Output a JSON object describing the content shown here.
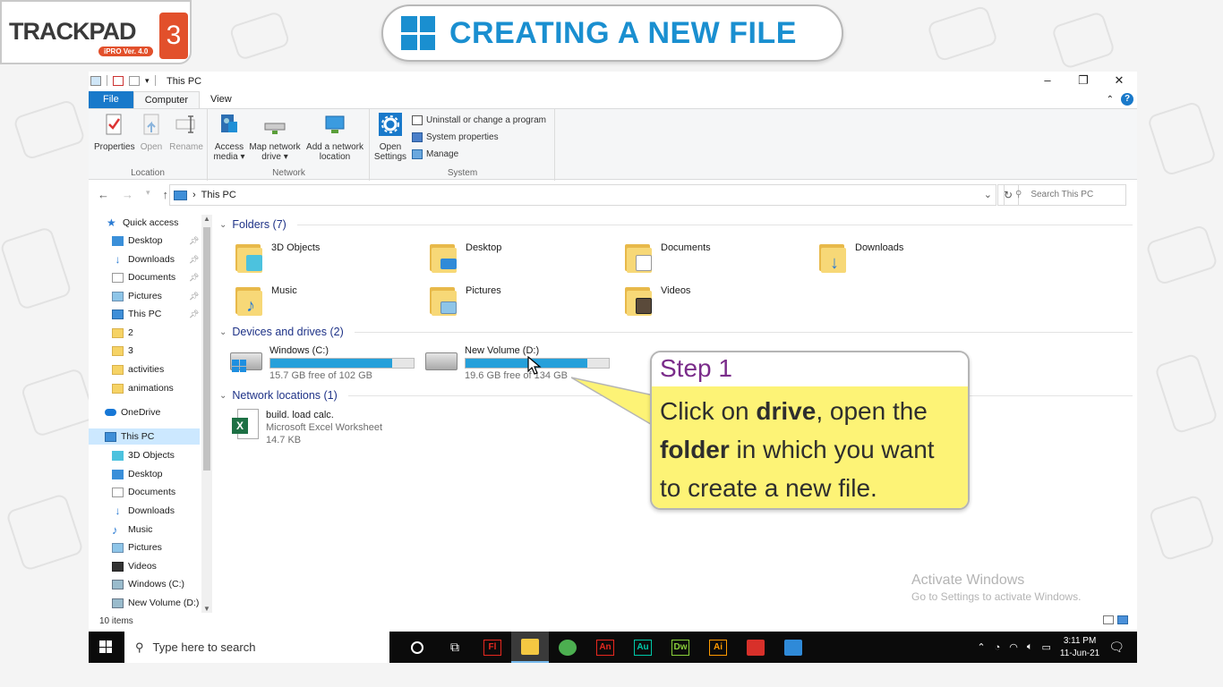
{
  "logo": {
    "word": "TRACKPAD",
    "sub": "iPRO Ver. 4.0",
    "num": "3"
  },
  "banner": {
    "title": "CREATING A NEW FILE"
  },
  "window": {
    "title": "This PC",
    "tabs": [
      "File",
      "Computer",
      "View"
    ],
    "ribbon": {
      "location": {
        "name": "Location",
        "buttons": [
          "Properties",
          "Open",
          "Rename"
        ]
      },
      "network": {
        "name": "Network",
        "access_media": "Access media ▾",
        "map_drive": "Map network drive ▾",
        "add_location": "Add a network location"
      },
      "system": {
        "name": "System",
        "open_settings": "Open Settings",
        "uninstall": "Uninstall or change a program",
        "sys_props": "System properties",
        "manage": "Manage"
      }
    },
    "address": {
      "path": "This PC",
      "search_placeholder": "Search This PC"
    },
    "nav": [
      {
        "label": "Quick access",
        "icon": "star-icon"
      },
      {
        "label": "Desktop",
        "icon": "desktop-icon"
      },
      {
        "label": "Downloads",
        "icon": "download-icon"
      },
      {
        "label": "Documents",
        "icon": "documents-icon"
      },
      {
        "label": "Pictures",
        "icon": "pictures-icon"
      },
      {
        "label": "This PC",
        "icon": "computer-icon"
      },
      {
        "label": "2",
        "icon": "folder-icon"
      },
      {
        "label": "3",
        "icon": "folder-icon"
      },
      {
        "label": "activities",
        "icon": "folder-icon"
      },
      {
        "label": "animations",
        "icon": "folder-icon"
      },
      {
        "label": "OneDrive",
        "icon": "cloud-icon"
      },
      {
        "label": "This PC",
        "icon": "computer-icon"
      },
      {
        "label": "3D Objects",
        "icon": "cube-icon"
      },
      {
        "label": "Desktop",
        "icon": "desktop-icon"
      },
      {
        "label": "Documents",
        "icon": "documents-icon"
      },
      {
        "label": "Downloads",
        "icon": "download-icon"
      },
      {
        "label": "Music",
        "icon": "music-icon"
      },
      {
        "label": "Pictures",
        "icon": "pictures-icon"
      },
      {
        "label": "Videos",
        "icon": "videos-icon"
      },
      {
        "label": "Windows (C:)",
        "icon": "drive-icon"
      },
      {
        "label": "New Volume (D:)",
        "icon": "drive-icon"
      }
    ],
    "sections": {
      "folders": "Folders (7)",
      "devices": "Devices and drives (2)",
      "network": "Network locations (1)"
    },
    "folders": [
      "3D Objects",
      "Desktop",
      "Documents",
      "Downloads",
      "Music",
      "Pictures",
      "Videos"
    ],
    "drives": [
      {
        "name": "Windows (C:)",
        "free": "15.7 GB free of 102 GB",
        "used_fraction": 0.85
      },
      {
        "name": "New Volume (D:)",
        "free": "19.6 GB free of 134 GB",
        "used_fraction": 0.85
      }
    ],
    "network_item": {
      "name": "build. load calc.",
      "type": "Microsoft Excel Worksheet",
      "size": "14.7 KB"
    },
    "status": "10 items",
    "watermark": {
      "line1": "Activate Windows",
      "line2": "Go to Settings to activate Windows."
    }
  },
  "callout": {
    "step": "Step 1",
    "t1": "Click on ",
    "b1": "drive",
    "t2": ", open the",
    "b2": "folder",
    "t3": " in which you want",
    "t4": "to create a new file."
  },
  "taskbar": {
    "search_placeholder": "Type here to search",
    "apps": [
      {
        "label": "Fl",
        "color": "#e8281f"
      },
      {
        "label": "",
        "color": "#f4c842"
      },
      {
        "label": "",
        "color": "#4caf50"
      },
      {
        "label": "An",
        "color": "#e8281f"
      },
      {
        "label": "Au",
        "color": "#00c8a8"
      },
      {
        "label": "Dw",
        "color": "#8ad13a"
      },
      {
        "label": "Ai",
        "color": "#ff9a00"
      },
      {
        "label": "",
        "color": "#d8302a"
      },
      {
        "label": "",
        "color": "#2f8ad8"
      }
    ],
    "time": "3:11 PM",
    "date": "11-Jun-21"
  },
  "colors": {
    "accent": "#1979ca",
    "title_blue": "#1a8fd0",
    "step_purple": "#7a2c8a",
    "callout_yellow": "#fdf376"
  }
}
